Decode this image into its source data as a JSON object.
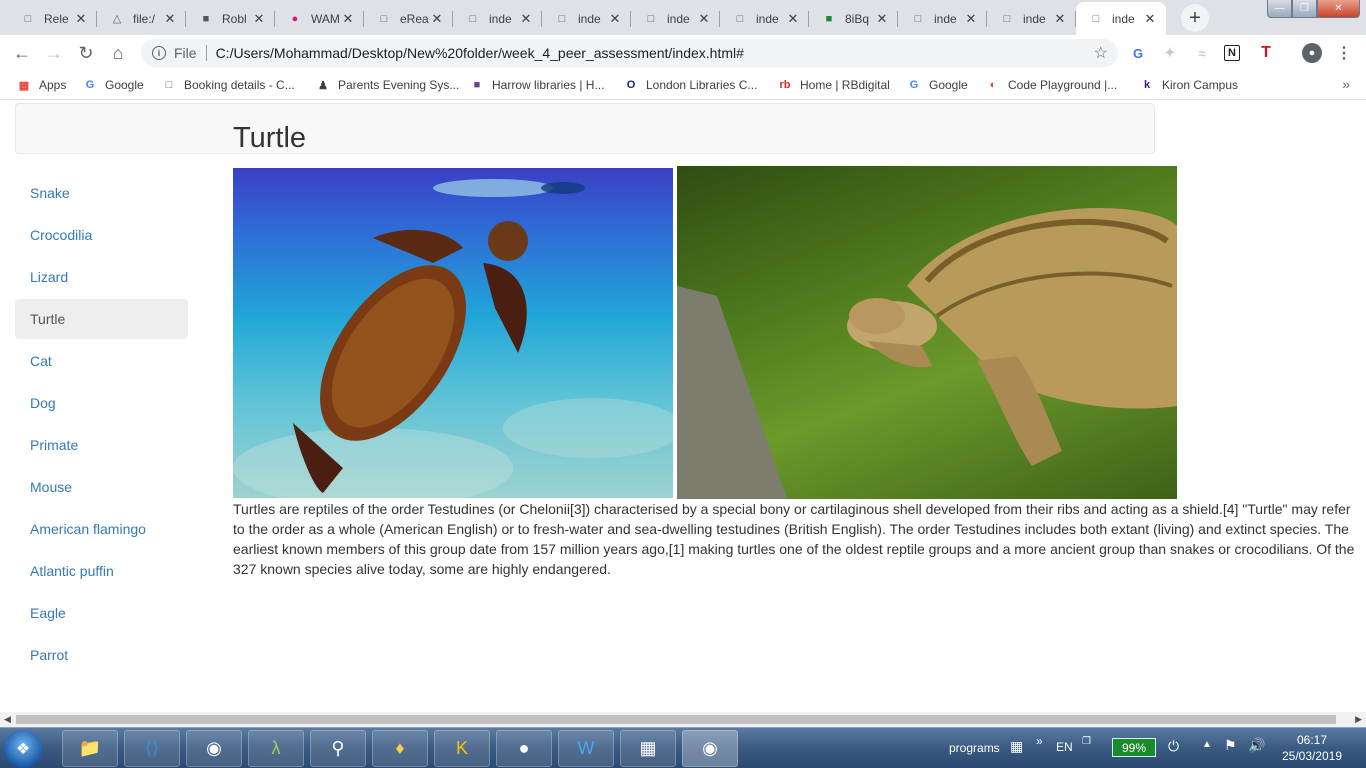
{
  "browser": {
    "tabs": [
      {
        "title": "Rele",
        "icon": "page-icon",
        "active": false
      },
      {
        "title": "file:/",
        "icon": "drive-icon",
        "active": false
      },
      {
        "title": "Robl",
        "icon": "roblox-icon",
        "active": false
      },
      {
        "title": "WAM",
        "icon": "wam-icon",
        "active": false
      },
      {
        "title": "eRea",
        "icon": "page-icon",
        "active": false
      },
      {
        "title": "inde",
        "icon": "page-icon",
        "active": false
      },
      {
        "title": "inde",
        "icon": "page-icon",
        "active": false
      },
      {
        "title": "inde",
        "icon": "page-icon",
        "active": false
      },
      {
        "title": "inde",
        "icon": "page-icon",
        "active": false
      },
      {
        "title": "8iBq",
        "icon": "green-app-icon",
        "active": false
      },
      {
        "title": "inde",
        "icon": "page-icon",
        "active": false
      },
      {
        "title": "inde",
        "icon": "page-icon",
        "active": false
      },
      {
        "title": "inde",
        "icon": "page-icon",
        "active": true
      }
    ],
    "address": {
      "scheme_label": "File",
      "url": "C:/Users/Mohammad/Desktop/New%20folder/week_4_peer_assessment/index.html#"
    },
    "bookmarks": [
      {
        "label": "Apps",
        "icon": "apps-grid-icon"
      },
      {
        "label": "Google",
        "icon": "google-icon"
      },
      {
        "label": "Booking details - C...",
        "icon": "page-icon"
      },
      {
        "label": "Parents Evening Sys...",
        "icon": "person-icon"
      },
      {
        "label": "Harrow libraries | H...",
        "icon": "harrow-icon"
      },
      {
        "label": "London Libraries C...",
        "icon": "london-libraries-icon"
      },
      {
        "label": "Home | RBdigital",
        "icon": "rbdigital-icon"
      },
      {
        "label": "Google",
        "icon": "google-icon"
      },
      {
        "label": "Code Playground |...",
        "icon": "code-playground-icon"
      },
      {
        "label": "Kiron Campus",
        "icon": "kiron-icon"
      }
    ]
  },
  "page": {
    "title": "Turtle",
    "nav": [
      {
        "label": "Snake",
        "active": false
      },
      {
        "label": "Crocodilia",
        "active": false
      },
      {
        "label": "Lizard",
        "active": false
      },
      {
        "label": "Turtle",
        "active": true
      },
      {
        "label": "Cat",
        "active": false
      },
      {
        "label": "Dog",
        "active": false
      },
      {
        "label": "Primate",
        "active": false
      },
      {
        "label": "Mouse",
        "active": false
      },
      {
        "label": "American flamingo",
        "active": false
      },
      {
        "label": "Atlantic puffin",
        "active": false
      },
      {
        "label": "Eagle",
        "active": false
      },
      {
        "label": "Parrot",
        "active": false
      }
    ],
    "body": "Turtles are reptiles of the order Testudines (or Chelonii[3]) characterised by a special bony or cartilaginous shell developed from their ribs and acting as a shield.[4] \"Turtle\" may refer to the order as a whole (American English) or to fresh-water and sea-dwelling testudines (British English). The order Testudines includes both extant (living) and extinct species. The earliest known members of this group date from 157 million years ago,[1] making turtles one of the oldest reptile groups and a more ancient group than snakes or crocodilians. Of the 327 known species alive today, some are highly endangered."
  },
  "taskbar": {
    "tray_label": "programs",
    "language": "EN",
    "battery": "99%",
    "time": "06:17",
    "date": "25/03/2019"
  }
}
